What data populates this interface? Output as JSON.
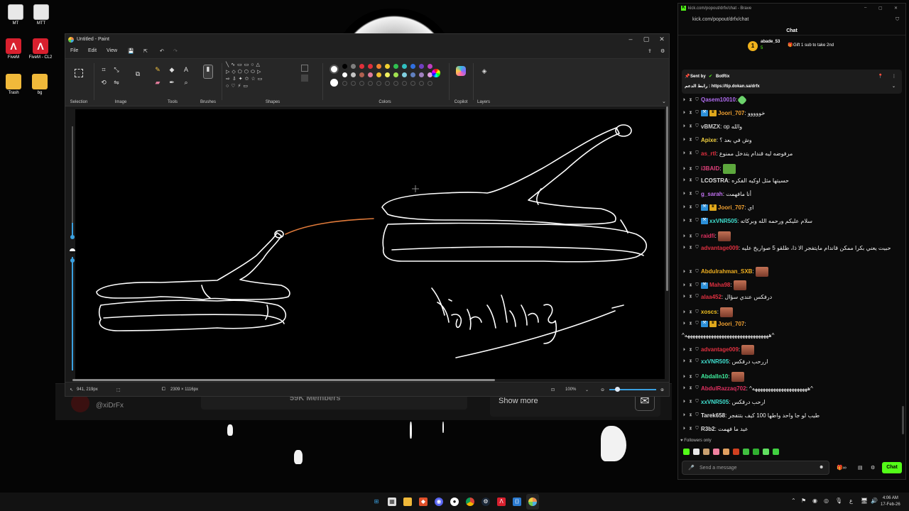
{
  "desktop": {
    "icons": [
      {
        "label": "MT"
      },
      {
        "label": "MTT"
      },
      {
        "label": "FiveM"
      },
      {
        "label": "FiveM - CL2"
      },
      {
        "label": "Trash"
      },
      {
        "label": "bg"
      }
    ]
  },
  "background_window": {
    "handle": "@xiDrFx",
    "members": "59K Members",
    "show_more": "Show more"
  },
  "paint": {
    "title": "Untitled - Paint",
    "menu": [
      "File",
      "Edit",
      "View"
    ],
    "groups": [
      "Selection",
      "Image",
      "Tools",
      "Brushes",
      "Shapes",
      "Colors",
      "Copilot",
      "Layers"
    ],
    "canvas_text": "handling",
    "status": {
      "cursor": "941, 219px",
      "size": "2309 × 1116px",
      "zoom": "100%"
    },
    "colors": {
      "stroke": "#ffffff",
      "accent_line": "#e07a3a"
    }
  },
  "browser": {
    "title": "kick.com/popout/drfx/chat - Brave",
    "url": "kick.com/popout/drfx/chat"
  },
  "chat": {
    "header": "Chat",
    "gifter": {
      "name": "abade_53",
      "count": "5",
      "note": "Gift 1 sub to take 2nd"
    },
    "pinned": {
      "sent_by_label": "Sent by",
      "sender": "BotRix",
      "text": "رابط الدعم : https://tip.dokan.sa/drfx"
    },
    "messages": [
      {
        "user": "Qasem10010",
        "color": "#b06cf0",
        "text": ""
      },
      {
        "user": "Joori_707",
        "color": "#f0a030",
        "text": "خووووو"
      },
      {
        "user": "vBMZX",
        "color": "#cccccc",
        "text": "op والله"
      },
      {
        "user": "Apixe",
        "color": "#f0d040",
        "text": "وش في بعد ؟"
      },
      {
        "user": "as_rtl",
        "color": "#e03040",
        "text": "مرفوضه ليه قندام يتدخل ممنوع"
      },
      {
        "user": "i3BAID",
        "color": "#e0407a",
        "text": ""
      },
      {
        "user": "LCOSTRA",
        "color": "#e0e0e0",
        "text": "حسيتها مثل اوكيه الفكره"
      },
      {
        "user": "g_sarah",
        "color": "#c070f0",
        "text": "أنا مافهمت"
      },
      {
        "user": "Joori_707",
        "color": "#f0a030",
        "text": "اي"
      },
      {
        "user": "xxVNR505",
        "color": "#40e0d0",
        "text": "سلام عليكم ورحمه الله وبركاته"
      },
      {
        "user": "raidfi",
        "color": "#e03060",
        "text": ""
      },
      {
        "user": "advantage009",
        "color": "#e03040",
        "text": "حبيت يعني بكرا ممكن قاندام مايتفجر الا ذا، طلقو 5 صواريخ عليه"
      },
      {
        "user": "Abdulrahman_SXB",
        "color": "#f0b020",
        "text": ""
      },
      {
        "user": "Maha98",
        "color": "#e03040",
        "text": ""
      },
      {
        "user": "alaa452",
        "color": "#e03040",
        "text": "درفكس عندي سؤال"
      },
      {
        "user": "xoscs",
        "color": "#f0c020",
        "text": ""
      },
      {
        "user": "Joori_707",
        "color": "#f0a030",
        "text": ""
      },
      {
        "user": "",
        "color": "#ffffff",
        "text": "^ههههههههههههههههههههههههههههههههه^"
      },
      {
        "user": "advantage009",
        "color": "#e03040",
        "text": ""
      },
      {
        "user": "xxVNR505",
        "color": "#40e0d0",
        "text": "اررحب درفكس"
      },
      {
        "user": "Abdalln10",
        "color": "#40f0a0",
        "text": ""
      },
      {
        "user": "AbdulRazzaq702",
        "color": "#e03060",
        "text": "^هههههههههههههههههههههه^"
      },
      {
        "user": "xxVNR505",
        "color": "#40e0d0",
        "text": "ارحب درفكس"
      },
      {
        "user": "Tarek658",
        "color": "#e0e0e0",
        "text": "طيب لو جا واحد واطها 100 كيف بتتفجر"
      },
      {
        "user": "R3b2",
        "color": "#e0e0e0",
        "text": "عيد ما فهمت"
      }
    ],
    "followers_only": "Followers only",
    "send_placeholder": "Send a message",
    "chat_button": "Chat"
  },
  "taskbar": {
    "time": "4:06 AM",
    "date": "17-Feb-26",
    "lang": "ع"
  }
}
